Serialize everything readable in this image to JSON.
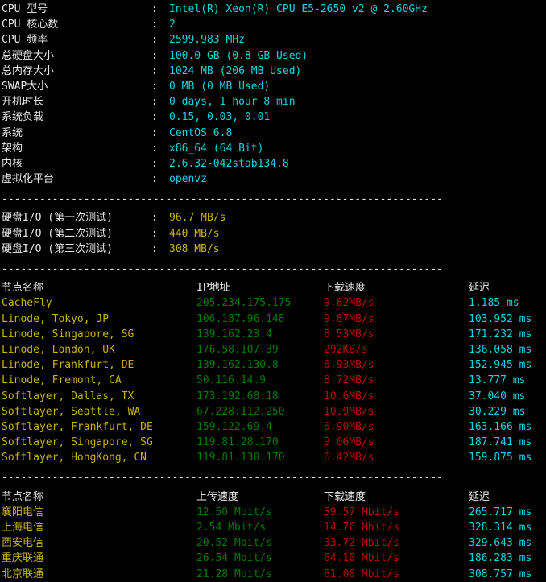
{
  "terminal": {
    "separator": "----------------------------------------------------------------------",
    "colors": {
      "background": "#000000",
      "label": "#e8e8e8",
      "value_cyan": "#12d3e0",
      "value_yellow": "#c8b400",
      "ip_green": "#007a00",
      "speed_red": "#b40000",
      "node_name_yellow": "#c8b400"
    }
  },
  "system_info": [
    {
      "label": "CPU 型号",
      "colon": ":",
      "value": "Intel(R) Xeon(R) CPU E5-2650 v2 @ 2.60GHz"
    },
    {
      "label": "CPU 核心数",
      "colon": ":",
      "value": "2"
    },
    {
      "label": "CPU 频率",
      "colon": ":",
      "value": "2599.983 MHz"
    },
    {
      "label": "总硬盘大小",
      "colon": ":",
      "value": "100.0 GB (0.8 GB Used)"
    },
    {
      "label": "总内存大小",
      "colon": ":",
      "value": "1024 MB (206 MB Used)"
    },
    {
      "label": "SWAP大小",
      "colon": ":",
      "value": "0 MB (0 MB Used)"
    },
    {
      "label": "开机时长",
      "colon": ":",
      "value": "0 days, 1 hour 8 min"
    },
    {
      "label": "系统负载",
      "colon": ":",
      "value": "0.15, 0.03, 0.01"
    },
    {
      "label": "系统",
      "colon": ":",
      "value": "CentOS 6.8"
    },
    {
      "label": "架构",
      "colon": ":",
      "value": "x86_64 (64 Bit)"
    },
    {
      "label": "内核",
      "colon": ":",
      "value": "2.6.32-042stab134.8"
    },
    {
      "label": "虚拟化平台",
      "colon": ":",
      "value": "openvz"
    }
  ],
  "disk_io": [
    {
      "label": "硬盘I/O (第一次测试)",
      "colon": ":",
      "value": "96.7 MB/s"
    },
    {
      "label": "硬盘I/O (第二次测试)",
      "colon": ":",
      "value": "440 MB/s"
    },
    {
      "label": "硬盘I/O (第三次测试)",
      "colon": ":",
      "value": "308 MB/s"
    }
  ],
  "speedtest_intl": {
    "headers": {
      "name": "节点名称",
      "ip": "IP地址",
      "download": "下载速度",
      "latency": "延迟"
    },
    "rows": [
      {
        "name": "CacheFly",
        "ip": "205.234.175.175",
        "download": "9.82MB/s",
        "latency": "1.185 ms"
      },
      {
        "name": "Linode, Tokyo, JP",
        "ip": "106.187.96.148",
        "download": "9.87MB/s",
        "latency": "103.952 ms"
      },
      {
        "name": "Linode, Singapore, SG",
        "ip": "139.162.23.4",
        "download": "8.53MB/s",
        "latency": "171.232 ms"
      },
      {
        "name": "Linode, London, UK",
        "ip": "176.58.107.39",
        "download": "292KB/s",
        "latency": "136.058 ms"
      },
      {
        "name": "Linode, Frankfurt, DE",
        "ip": "139.162.130.8",
        "download": "6.93MB/s",
        "latency": "152.945 ms"
      },
      {
        "name": "Linode, Fremont, CA",
        "ip": "50.116.14.9",
        "download": "8.72MB/s",
        "latency": "13.777 ms"
      },
      {
        "name": "Softlayer, Dallas, TX",
        "ip": "173.192.68.18",
        "download": "10.6MB/s",
        "latency": "37.040 ms"
      },
      {
        "name": "Softlayer, Seattle, WA",
        "ip": "67.228.112.250",
        "download": "10.9MB/s",
        "latency": "30.229 ms"
      },
      {
        "name": "Softlayer, Frankfurt, DE",
        "ip": "159.122.69.4",
        "download": "6.90MB/s",
        "latency": "163.166 ms"
      },
      {
        "name": "Softlayer, Singapore, SG",
        "ip": "119.81.28.170",
        "download": "9.06MB/s",
        "latency": "187.741 ms"
      },
      {
        "name": "Softlayer, HongKong, CN",
        "ip": "119.81.130.170",
        "download": "6.42MB/s",
        "latency": "159.875 ms"
      }
    ]
  },
  "speedtest_cn": {
    "headers": {
      "name": "节点名称",
      "upload": "上传速度",
      "download": "下载速度",
      "latency": "延迟"
    },
    "rows": [
      {
        "name": "襄阳电信",
        "upload": "12.50 Mbit/s",
        "download": "59.57 Mbit/s",
        "latency": "265.717 ms"
      },
      {
        "name": "上海电信",
        "upload": "2.54 Mbit/s",
        "download": "14.76 Mbit/s",
        "latency": "328.314 ms"
      },
      {
        "name": "西安电信",
        "upload": "20.52 Mbit/s",
        "download": "33.72 Mbit/s",
        "latency": "329.643 ms"
      },
      {
        "name": "重庆联通",
        "upload": "26.54 Mbit/s",
        "download": "64.10 Mbit/s",
        "latency": "186.283 ms"
      },
      {
        "name": "北京联通",
        "upload": "21.28 Mbit/s",
        "download": "61.00 Mbit/s",
        "latency": "308.757 ms"
      }
    ]
  }
}
